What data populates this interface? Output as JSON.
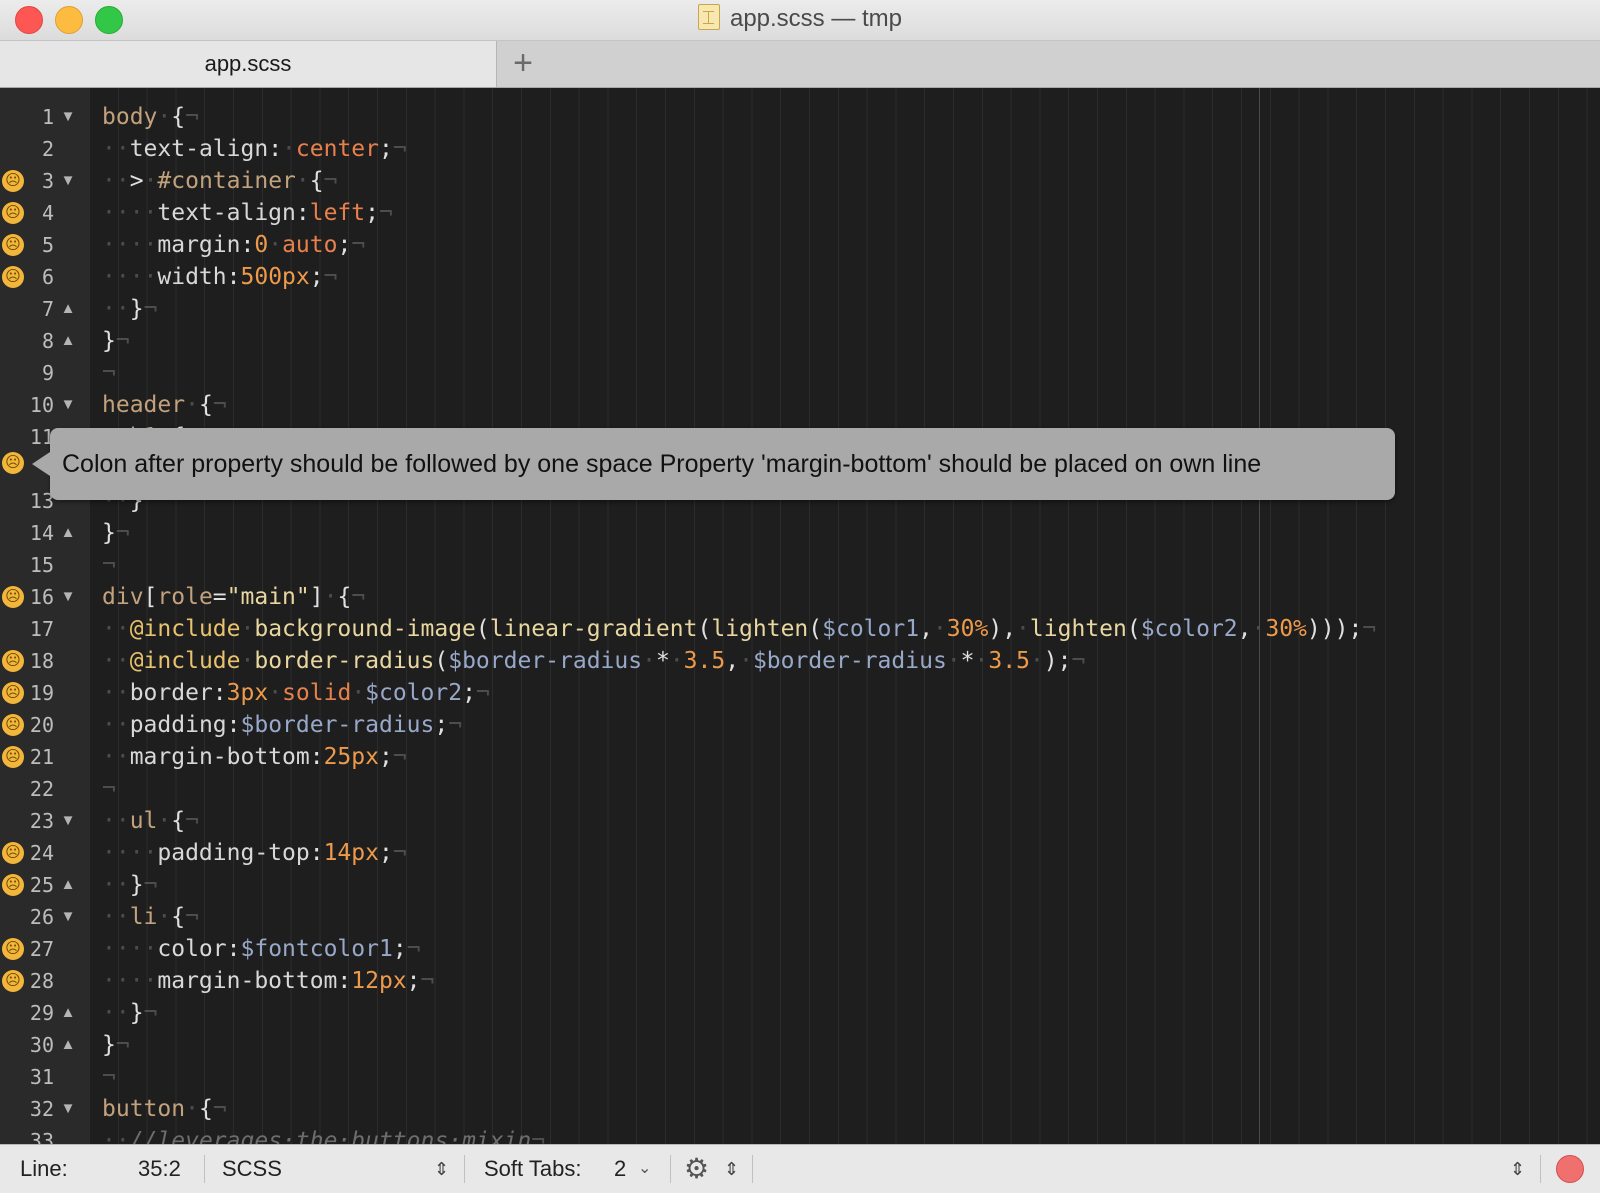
{
  "window": {
    "title": "app.scss — tmp",
    "file_icon": "document-icon"
  },
  "tabs": [
    {
      "label": "app.scss",
      "active": true
    }
  ],
  "add_tab_label": "+",
  "lint_icon": "worried-face-icon",
  "tooltip": "Colon after property should be followed by one space Property 'margin-bottom' should be placed on own line",
  "lines": [
    {
      "n": "1",
      "warn": false,
      "fold": "▼"
    },
    {
      "n": "2",
      "warn": false,
      "fold": ""
    },
    {
      "n": "3",
      "warn": true,
      "fold": "▼"
    },
    {
      "n": "4",
      "warn": true,
      "fold": ""
    },
    {
      "n": "5",
      "warn": true,
      "fold": ""
    },
    {
      "n": "6",
      "warn": true,
      "fold": ""
    },
    {
      "n": "7",
      "warn": false,
      "fold": "▲"
    },
    {
      "n": "8",
      "warn": false,
      "fold": "▲"
    },
    {
      "n": "9",
      "warn": false,
      "fold": ""
    },
    {
      "n": "10",
      "warn": false,
      "fold": "▼"
    },
    {
      "n": "11",
      "warn": false,
      "fold": ""
    },
    {
      "n": "",
      "warn": true,
      "fold": ""
    },
    {
      "n": "13",
      "warn": false,
      "fold": ""
    },
    {
      "n": "14",
      "warn": false,
      "fold": "▲"
    },
    {
      "n": "15",
      "warn": false,
      "fold": ""
    },
    {
      "n": "16",
      "warn": true,
      "fold": "▼"
    },
    {
      "n": "17",
      "warn": false,
      "fold": ""
    },
    {
      "n": "18",
      "warn": true,
      "fold": ""
    },
    {
      "n": "19",
      "warn": true,
      "fold": ""
    },
    {
      "n": "20",
      "warn": true,
      "fold": ""
    },
    {
      "n": "21",
      "warn": true,
      "fold": ""
    },
    {
      "n": "22",
      "warn": false,
      "fold": ""
    },
    {
      "n": "23",
      "warn": false,
      "fold": "▼"
    },
    {
      "n": "24",
      "warn": true,
      "fold": ""
    },
    {
      "n": "25",
      "warn": true,
      "fold": "▲"
    },
    {
      "n": "26",
      "warn": false,
      "fold": "▼"
    },
    {
      "n": "27",
      "warn": true,
      "fold": ""
    },
    {
      "n": "28",
      "warn": true,
      "fold": ""
    },
    {
      "n": "29",
      "warn": false,
      "fold": "▲"
    },
    {
      "n": "30",
      "warn": false,
      "fold": "▲"
    },
    {
      "n": "31",
      "warn": false,
      "fold": ""
    },
    {
      "n": "32",
      "warn": false,
      "fold": "▼"
    },
    {
      "n": "33",
      "warn": false,
      "fold": ""
    }
  ],
  "code": [
    [
      [
        "sel",
        "body"
      ],
      [
        "ws",
        "·"
      ],
      [
        "p",
        "{"
      ],
      [
        "ws",
        "¬"
      ]
    ],
    [
      [
        "ws",
        "··"
      ],
      [
        "prop",
        "text-align"
      ],
      [
        "p",
        ":"
      ],
      [
        "ws",
        "·"
      ],
      [
        "kw",
        "center"
      ],
      [
        "p",
        ";"
      ],
      [
        "ws",
        "¬"
      ]
    ],
    [
      [
        "ws",
        "··"
      ],
      [
        "p",
        ">"
      ],
      [
        "ws",
        "·"
      ],
      [
        "sel",
        "#container"
      ],
      [
        "ws",
        "·"
      ],
      [
        "p",
        "{"
      ],
      [
        "ws",
        "¬"
      ]
    ],
    [
      [
        "ws",
        "····"
      ],
      [
        "prop",
        "text-align"
      ],
      [
        "p",
        ":"
      ],
      [
        "kw",
        "left"
      ],
      [
        "p",
        ";"
      ],
      [
        "ws",
        "¬"
      ]
    ],
    [
      [
        "ws",
        "····"
      ],
      [
        "prop",
        "margin"
      ],
      [
        "p",
        ":"
      ],
      [
        "num",
        "0"
      ],
      [
        "ws",
        "·"
      ],
      [
        "kw",
        "auto"
      ],
      [
        "p",
        ";"
      ],
      [
        "ws",
        "¬"
      ]
    ],
    [
      [
        "ws",
        "····"
      ],
      [
        "prop",
        "width"
      ],
      [
        "p",
        ":"
      ],
      [
        "num",
        "500px"
      ],
      [
        "p",
        ";"
      ],
      [
        "ws",
        "¬"
      ]
    ],
    [
      [
        "ws",
        "··"
      ],
      [
        "p",
        "}"
      ],
      [
        "ws",
        "¬"
      ]
    ],
    [
      [
        "p",
        "}"
      ],
      [
        "ws",
        "¬"
      ]
    ],
    [
      [
        "ws",
        "¬"
      ]
    ],
    [
      [
        "sel",
        "header"
      ],
      [
        "ws",
        "·"
      ],
      [
        "p",
        "{"
      ],
      [
        "ws",
        "¬"
      ]
    ],
    [
      [
        "ws",
        "··"
      ],
      [
        "sel",
        "h1"
      ],
      [
        "ws",
        "·"
      ],
      [
        "p",
        "{"
      ]
    ],
    [],
    [
      [
        "ws",
        "··"
      ],
      [
        "p",
        "}"
      ]
    ],
    [
      [
        "p",
        "}"
      ],
      [
        "ws",
        "¬"
      ]
    ],
    [
      [
        "ws",
        "¬"
      ]
    ],
    [
      [
        "sel",
        "div"
      ],
      [
        "p",
        "["
      ],
      [
        "sel",
        "role"
      ],
      [
        "p",
        "="
      ],
      [
        "str",
        "\"main\""
      ],
      [
        "p",
        "]"
      ],
      [
        "ws",
        "·"
      ],
      [
        "p",
        "{"
      ],
      [
        "ws",
        "¬"
      ]
    ],
    [
      [
        "ws",
        "··"
      ],
      [
        "at",
        "@include"
      ],
      [
        "ws",
        "·"
      ],
      [
        "fn",
        "background-image"
      ],
      [
        "p",
        "("
      ],
      [
        "fn",
        "linear-gradient"
      ],
      [
        "p",
        "("
      ],
      [
        "fn",
        "lighten"
      ],
      [
        "p",
        "("
      ],
      [
        "var",
        "$color1"
      ],
      [
        "p",
        ","
      ],
      [
        "ws",
        "·"
      ],
      [
        "num",
        "30%"
      ],
      [
        "p",
        "),"
      ],
      [
        "ws",
        "·"
      ],
      [
        "fn",
        "lighten"
      ],
      [
        "p",
        "("
      ],
      [
        "var",
        "$color2"
      ],
      [
        "p",
        ","
      ],
      [
        "ws",
        "·"
      ],
      [
        "num",
        "30%"
      ],
      [
        "p",
        ")));"
      ],
      [
        "ws",
        "¬"
      ]
    ],
    [
      [
        "ws",
        "··"
      ],
      [
        "at",
        "@include"
      ],
      [
        "ws",
        "·"
      ],
      [
        "fn",
        "border-radius"
      ],
      [
        "p",
        "("
      ],
      [
        "var",
        "$border-radius"
      ],
      [
        "ws",
        "·"
      ],
      [
        "p",
        "*"
      ],
      [
        "ws",
        "·"
      ],
      [
        "num",
        "3.5"
      ],
      [
        "p",
        ","
      ],
      [
        "ws",
        "·"
      ],
      [
        "var",
        "$border-radius"
      ],
      [
        "ws",
        "·"
      ],
      [
        "p",
        "*"
      ],
      [
        "ws",
        "·"
      ],
      [
        "num",
        "3.5"
      ],
      [
        "ws",
        "·"
      ],
      [
        "p",
        ");"
      ],
      [
        "ws",
        "¬"
      ]
    ],
    [
      [
        "ws",
        "··"
      ],
      [
        "prop",
        "border"
      ],
      [
        "p",
        ":"
      ],
      [
        "num",
        "3px"
      ],
      [
        "ws",
        "·"
      ],
      [
        "kw",
        "solid"
      ],
      [
        "ws",
        "·"
      ],
      [
        "var",
        "$color2"
      ],
      [
        "p",
        ";"
      ],
      [
        "ws",
        "¬"
      ]
    ],
    [
      [
        "ws",
        "··"
      ],
      [
        "prop",
        "padding"
      ],
      [
        "p",
        ":"
      ],
      [
        "var",
        "$border-radius"
      ],
      [
        "p",
        ";"
      ],
      [
        "ws",
        "¬"
      ]
    ],
    [
      [
        "ws",
        "··"
      ],
      [
        "prop",
        "margin-bottom"
      ],
      [
        "p",
        ":"
      ],
      [
        "num",
        "25px"
      ],
      [
        "p",
        ";"
      ],
      [
        "ws",
        "¬"
      ]
    ],
    [
      [
        "ws",
        "¬"
      ]
    ],
    [
      [
        "ws",
        "··"
      ],
      [
        "sel",
        "ul"
      ],
      [
        "ws",
        "·"
      ],
      [
        "p",
        "{"
      ],
      [
        "ws",
        "¬"
      ]
    ],
    [
      [
        "ws",
        "····"
      ],
      [
        "prop",
        "padding-top"
      ],
      [
        "p",
        ":"
      ],
      [
        "num",
        "14px"
      ],
      [
        "p",
        ";"
      ],
      [
        "ws",
        "¬"
      ]
    ],
    [
      [
        "ws",
        "··"
      ],
      [
        "p",
        "}"
      ],
      [
        "ws",
        "¬"
      ]
    ],
    [
      [
        "ws",
        "··"
      ],
      [
        "sel",
        "li"
      ],
      [
        "ws",
        "·"
      ],
      [
        "p",
        "{"
      ],
      [
        "ws",
        "¬"
      ]
    ],
    [
      [
        "ws",
        "····"
      ],
      [
        "prop",
        "color"
      ],
      [
        "p",
        ":"
      ],
      [
        "var",
        "$fontcolor1"
      ],
      [
        "p",
        ";"
      ],
      [
        "ws",
        "¬"
      ]
    ],
    [
      [
        "ws",
        "····"
      ],
      [
        "prop",
        "margin-bottom"
      ],
      [
        "p",
        ":"
      ],
      [
        "num",
        "12px"
      ],
      [
        "p",
        ";"
      ],
      [
        "ws",
        "¬"
      ]
    ],
    [
      [
        "ws",
        "··"
      ],
      [
        "p",
        "}"
      ],
      [
        "ws",
        "¬"
      ]
    ],
    [
      [
        "p",
        "}"
      ],
      [
        "ws",
        "¬"
      ]
    ],
    [
      [
        "ws",
        "¬"
      ]
    ],
    [
      [
        "sel",
        "button"
      ],
      [
        "ws",
        "·"
      ],
      [
        "p",
        "{"
      ],
      [
        "ws",
        "¬"
      ]
    ],
    [
      [
        "ws",
        "··"
      ],
      [
        "cmt",
        "//leverages·the·buttons·mixin"
      ],
      [
        "ws",
        "¬"
      ]
    ]
  ],
  "status": {
    "line_label": "Line:",
    "line_value": "35:2",
    "syntax": "SCSS",
    "tabs_label": "Soft Tabs:",
    "tabs_value": "2",
    "settings_icon": "gear-icon",
    "updown_icon": "⌃⌄",
    "record_icon": "record-icon"
  }
}
